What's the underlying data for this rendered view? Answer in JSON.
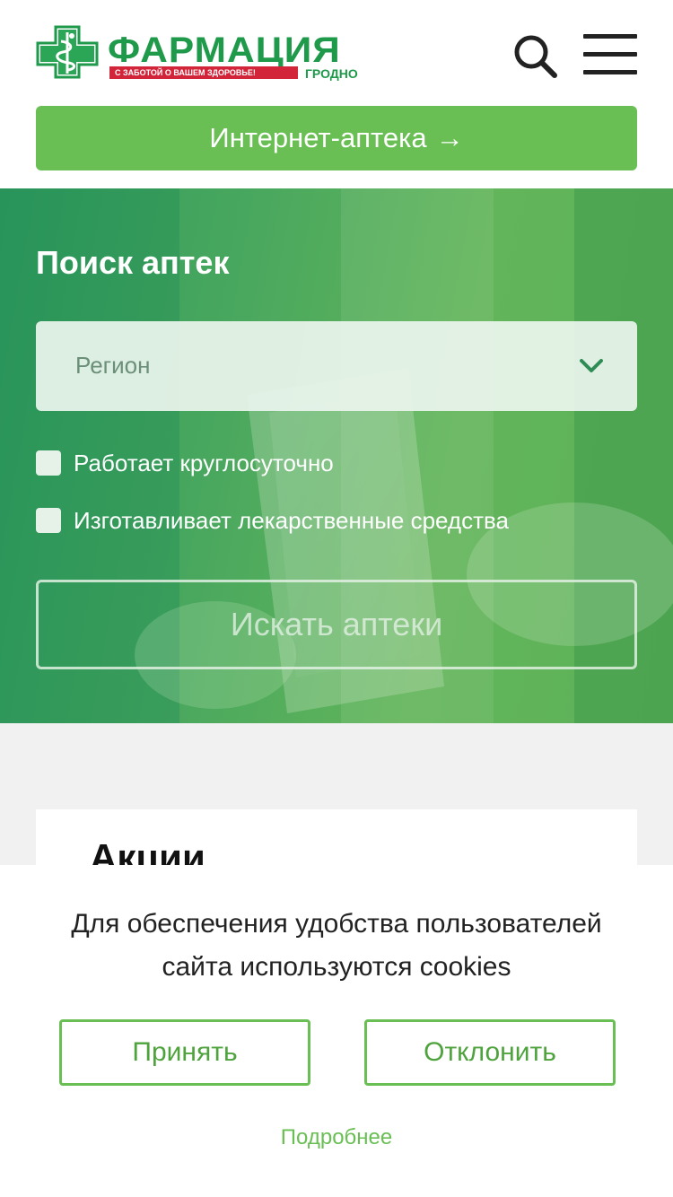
{
  "header": {
    "logo_name": "ФАРМАЦИЯ",
    "logo_tagline": "С ЗАБОТОЙ О ВАШЕМ ЗДОРОВЬЕ!",
    "logo_city": "ГРОДНО",
    "internet_pharmacy_label": "Интернет-аптека",
    "internet_pharmacy_arrow": "→"
  },
  "hero": {
    "title": "Поиск аптек",
    "region_placeholder": "Регион",
    "filters": [
      {
        "label": "Работает круглосуточно",
        "checked": false
      },
      {
        "label": "Изготавливает лекарственные средства",
        "checked": false
      }
    ],
    "search_button": "Искать аптеки"
  },
  "promo": {
    "title": "Акции"
  },
  "cookie": {
    "message": "Для обеспечения удобства пользователей сайта используются cookies",
    "accept": "Принять",
    "decline": "Отклонить",
    "more": "Подробнее"
  },
  "colors": {
    "brand_green": "#69bf53",
    "logo_green": "#1f9a4b",
    "logo_red": "#d3253a"
  },
  "icons": [
    "pharmacy-cross-logo-icon",
    "search-icon",
    "menu-icon",
    "chevron-down-icon",
    "arrow-right-icon"
  ]
}
